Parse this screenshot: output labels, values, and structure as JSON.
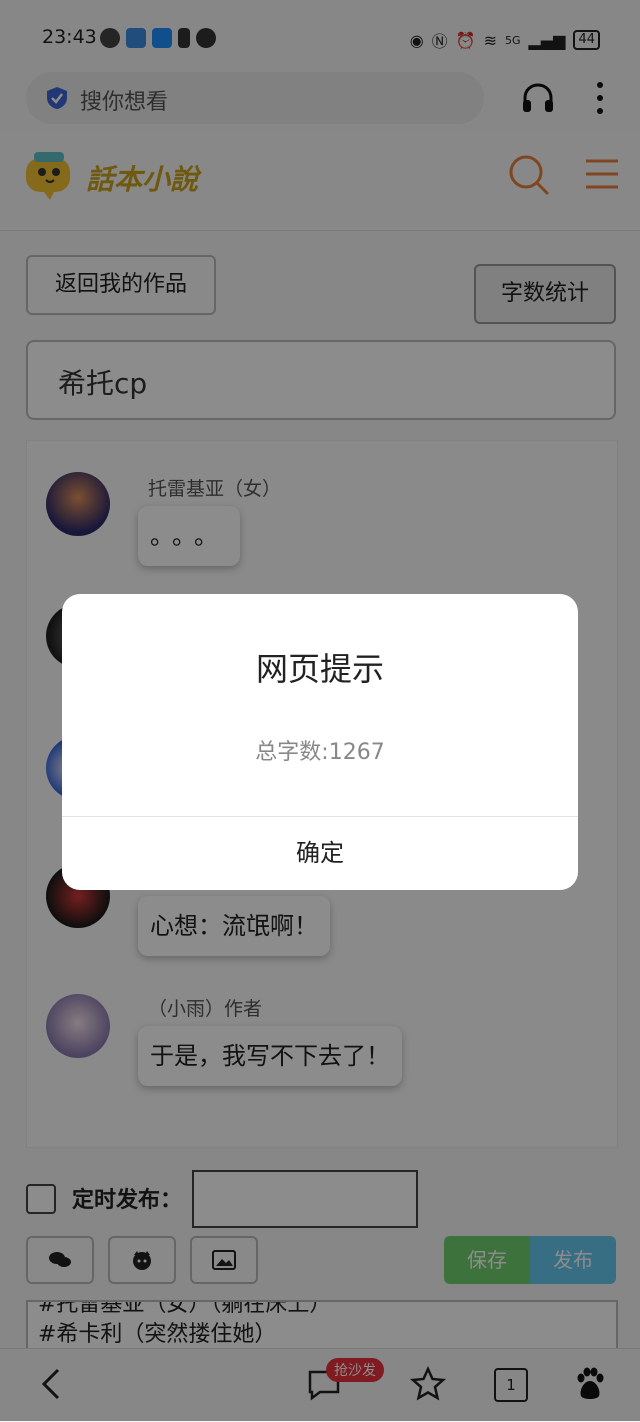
{
  "status_bar": {
    "time": "23:43",
    "network": "5G",
    "battery": "44"
  },
  "browser": {
    "search_placeholder": "搜你想看",
    "icons": [
      "shield-icon",
      "headphones-icon",
      "more-vertical-icon"
    ]
  },
  "site": {
    "logo_text": "話本小說",
    "icons": [
      "search-icon",
      "menu-icon"
    ]
  },
  "page": {
    "back_button": "返回我的作品",
    "word_count_button": "字数统计",
    "title_value": "希托cp"
  },
  "messages": [
    {
      "name": "托雷基亚（女）",
      "text": "。。。"
    },
    {
      "name": "",
      "text": ""
    },
    {
      "name": "",
      "text": ""
    },
    {
      "name": "",
      "text": "心想：流氓啊！"
    },
    {
      "name": "（小雨）作者",
      "text": "于是，我写不下去了！"
    }
  ],
  "controls": {
    "schedule_label": "定时发布：",
    "schedule_value": "",
    "save_button": "保存",
    "publish_button": "发布",
    "editor_lines": [
      "#托雷基亚（女）（躺在床上）",
      "#希卡利（突然搂住她）"
    ]
  },
  "bottom_nav": {
    "badge": "抢沙发",
    "tab_count": "1"
  },
  "dialog": {
    "title": "网页提示",
    "message": "总字数:1267",
    "ok_button": "确定"
  },
  "colors": {
    "save": "#6fcf6f",
    "publish": "#67c8f0",
    "badge": "#e8323c",
    "logo": "#c9a21a",
    "accent": "#e8823c"
  }
}
